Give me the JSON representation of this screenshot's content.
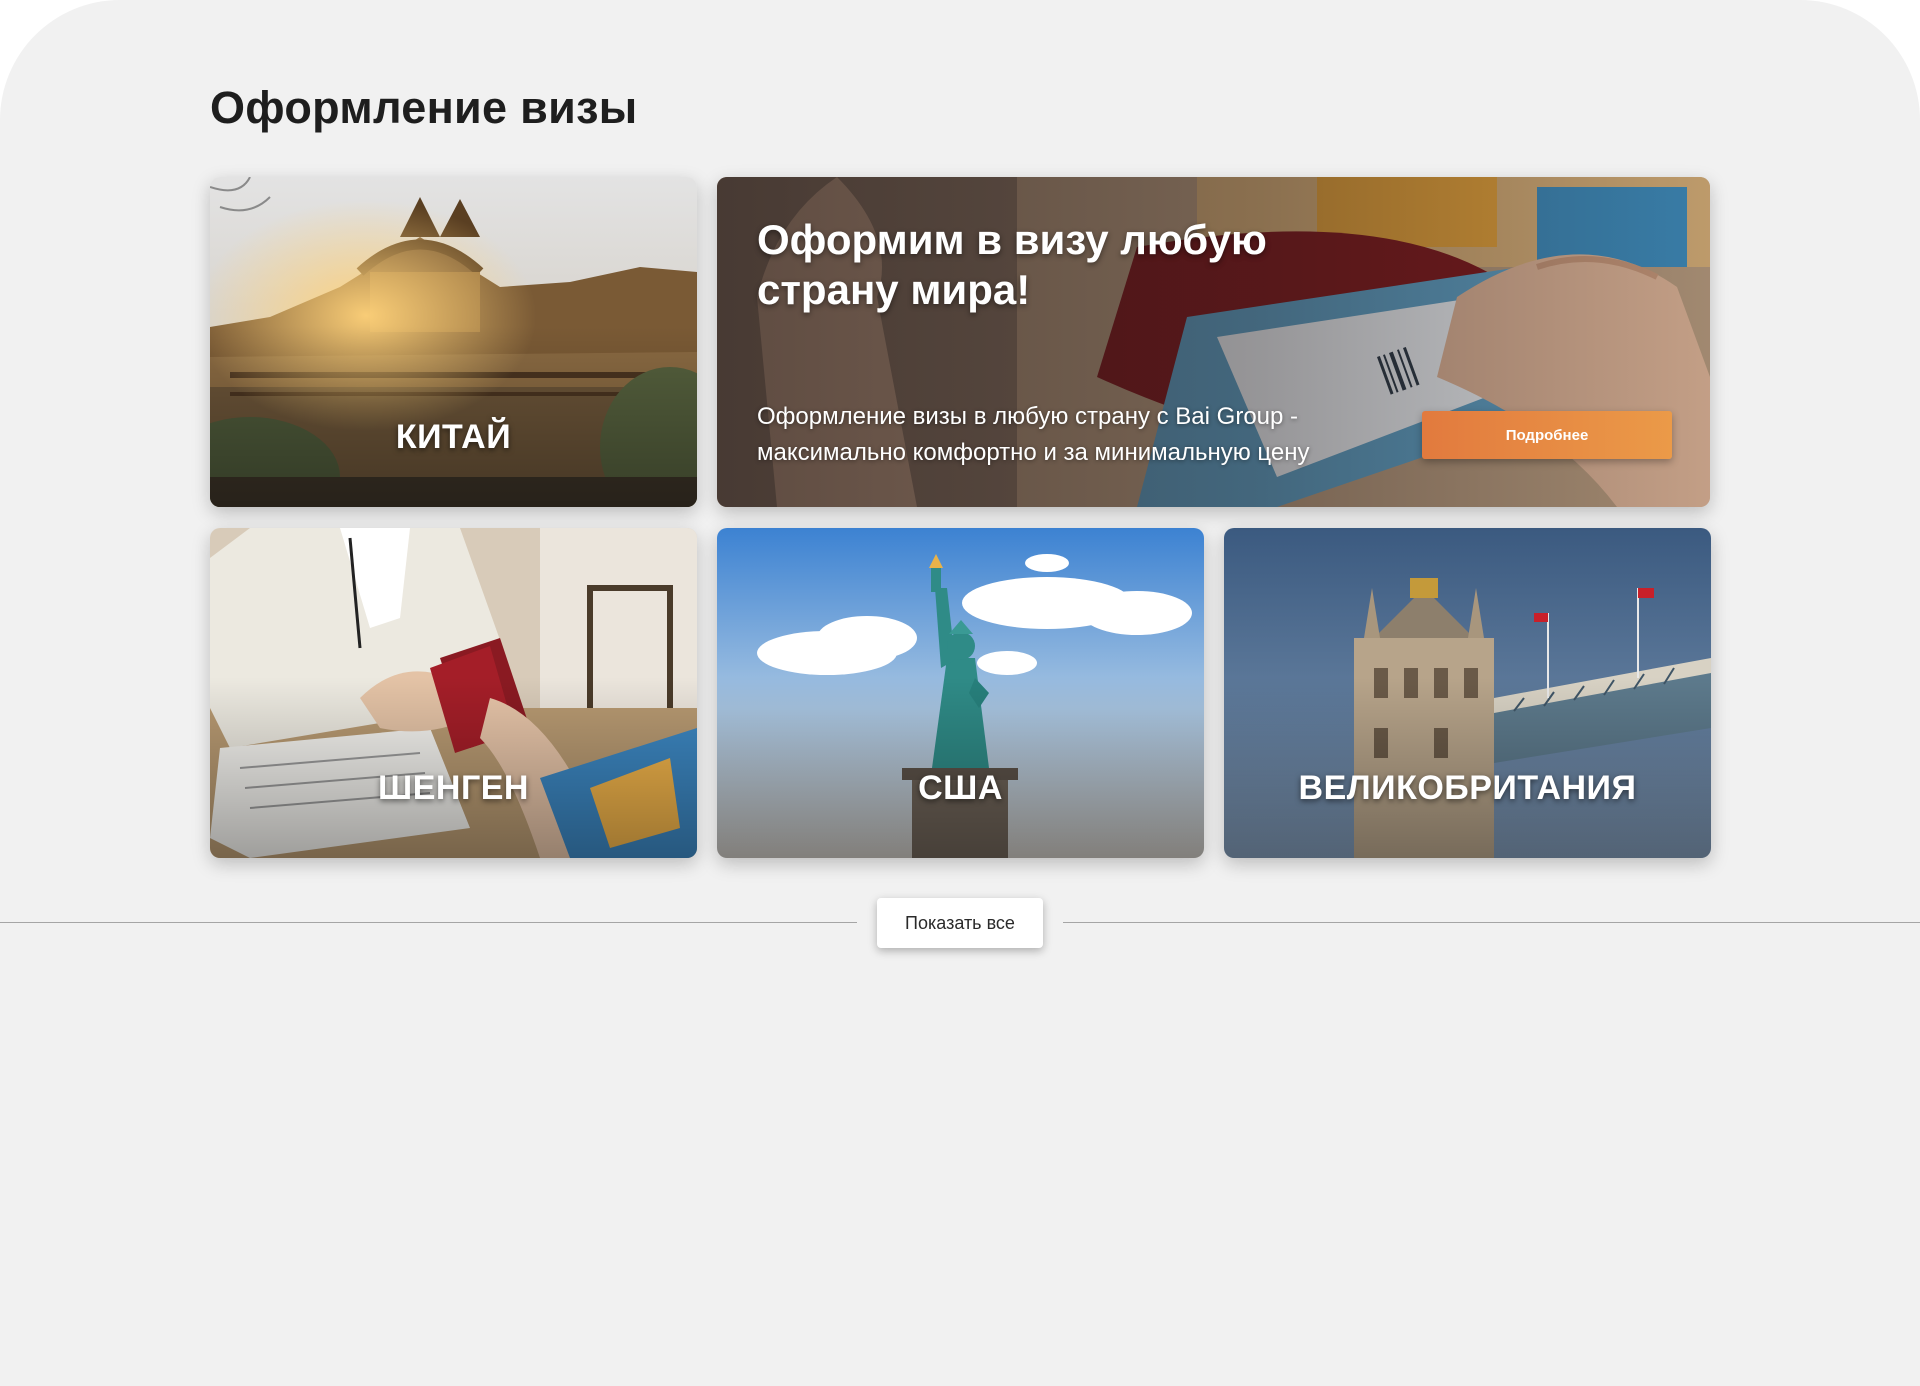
{
  "section": {
    "title": "Оформление визы"
  },
  "promo": {
    "title": "Оформим в визу любую страну мира!",
    "text": "Оформление визы в любую страну с Bai Group - максимально комфортно и за минимальную цену",
    "button_label": "Подробнее"
  },
  "cards": [
    {
      "label": "КИТАЙ"
    },
    {
      "label": "ШЕНГЕН"
    },
    {
      "label": "США"
    },
    {
      "label": "ВЕЛИКОБРИТАНИЯ"
    }
  ],
  "show_all_label": "Показать все",
  "colors": {
    "page_bg": "#f1f1f1",
    "accent_orange": "#e8873f",
    "title_text": "#1e1e1e",
    "divider": "#a5a5a5"
  }
}
